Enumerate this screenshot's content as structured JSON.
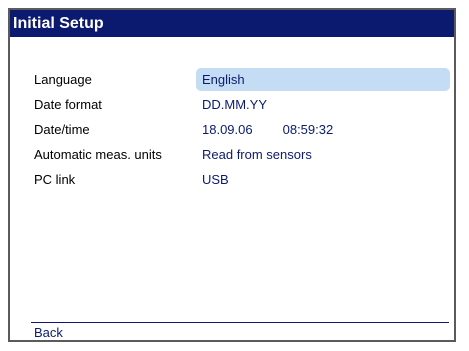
{
  "window": {
    "title": "Initial Setup"
  },
  "settings": {
    "language": {
      "label": "Language",
      "value": "English"
    },
    "date_format": {
      "label": "Date format",
      "value": "DD.MM.YY"
    },
    "date_time": {
      "label": "Date/time",
      "date": "18.09.06",
      "time": "08:59:32"
    },
    "automatic_units": {
      "label": "Automatic meas. units",
      "value": "Read from sensors"
    },
    "pc_link": {
      "label": "PC link",
      "value": "USB"
    }
  },
  "footer": {
    "back_label": "Back"
  },
  "colors": {
    "title_bar": "#0b1a6f",
    "value_text": "#0b1a6f",
    "selection_highlight": "#c4dcf4",
    "frame_border": "#5b5b5b"
  }
}
